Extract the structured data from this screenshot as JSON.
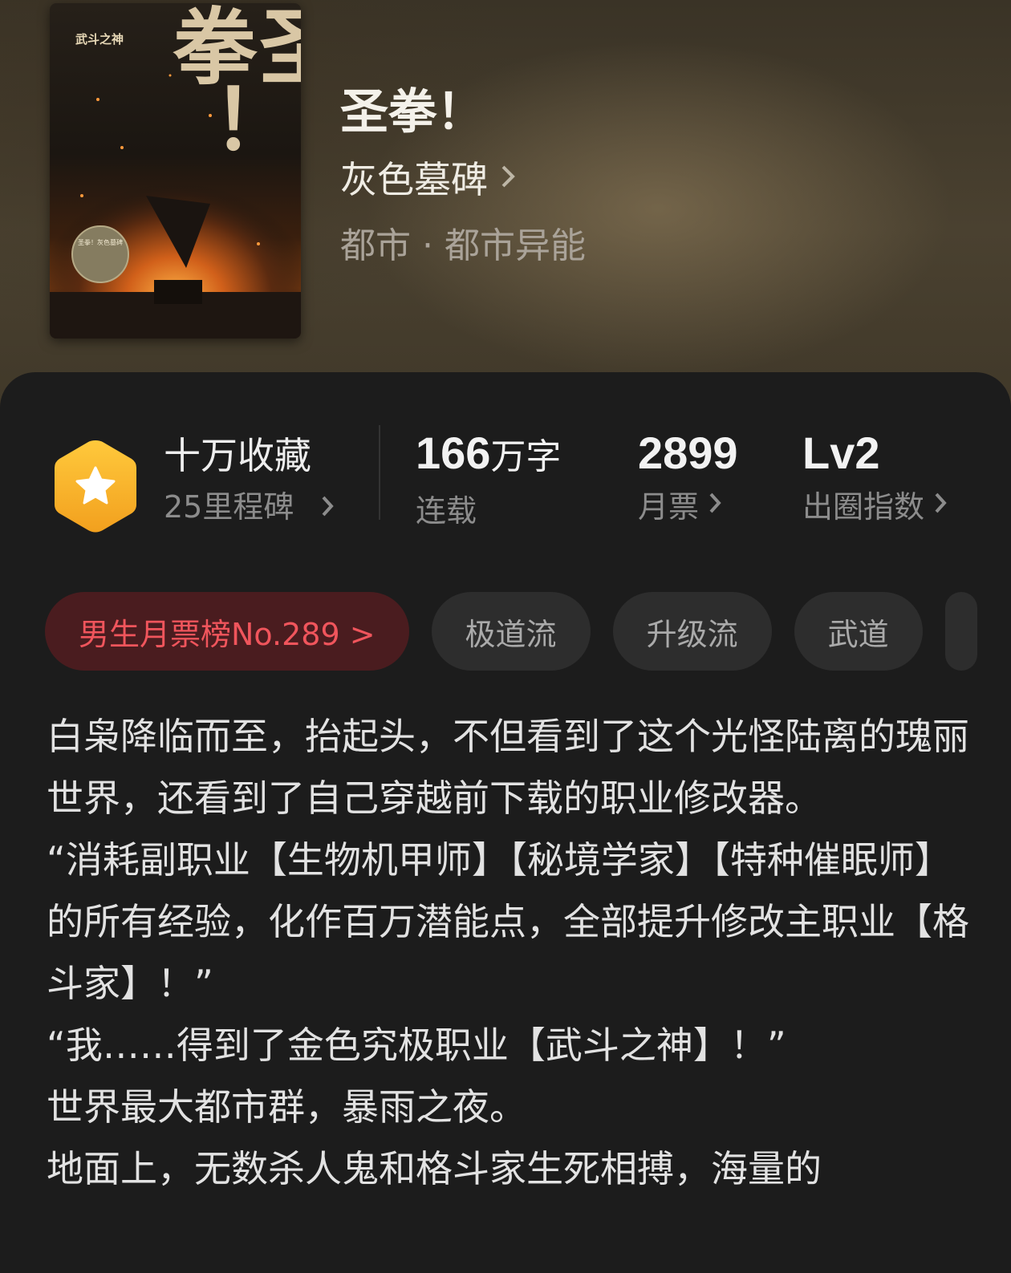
{
  "book": {
    "title": "圣拳！",
    "author": "灰色墓碑",
    "genre": "都市 · 都市异能",
    "cover": {
      "title_text": "圣拳！",
      "series_text": "武斗之神",
      "badge_text": "圣拳！灰色墓碑"
    }
  },
  "stats": {
    "favorites": {
      "title": "十万收藏",
      "sub": "25里程碑"
    },
    "words": {
      "value": "166",
      "unit": "万字",
      "label": "连载"
    },
    "tickets": {
      "value": "2899",
      "label": "月票"
    },
    "index": {
      "value": "Lv2",
      "label": "出圈指数"
    }
  },
  "tags": {
    "rank": "男生月票榜No.289 >",
    "items": [
      "极道流",
      "升级流",
      "武道"
    ]
  },
  "description": [
    "白枭降临而至，抬起头，不但看到了这个光怪陆离的瑰丽世界，还看到了自己穿越前下载的职业修改器。",
    "“消耗副职业【生物机甲师】【秘境学家】【特种催眠师】的所有经验，化作百万潜能点，全部提升修改主职业【格斗家】！”",
    "“我……得到了金色究极职业【武斗之神】！”",
    "世界最大都市群，暴雨之夜。",
    "地面上，无数杀人鬼和格斗家生死相搏，海量的"
  ],
  "colors": {
    "accent_rank_bg": "#4a1c1f",
    "accent_rank_text": "#f0555c",
    "badge_gold": "#f5a623"
  },
  "icons": {
    "favorites_badge": "star-hexagon-icon",
    "chevron": "chevron-right-icon"
  }
}
